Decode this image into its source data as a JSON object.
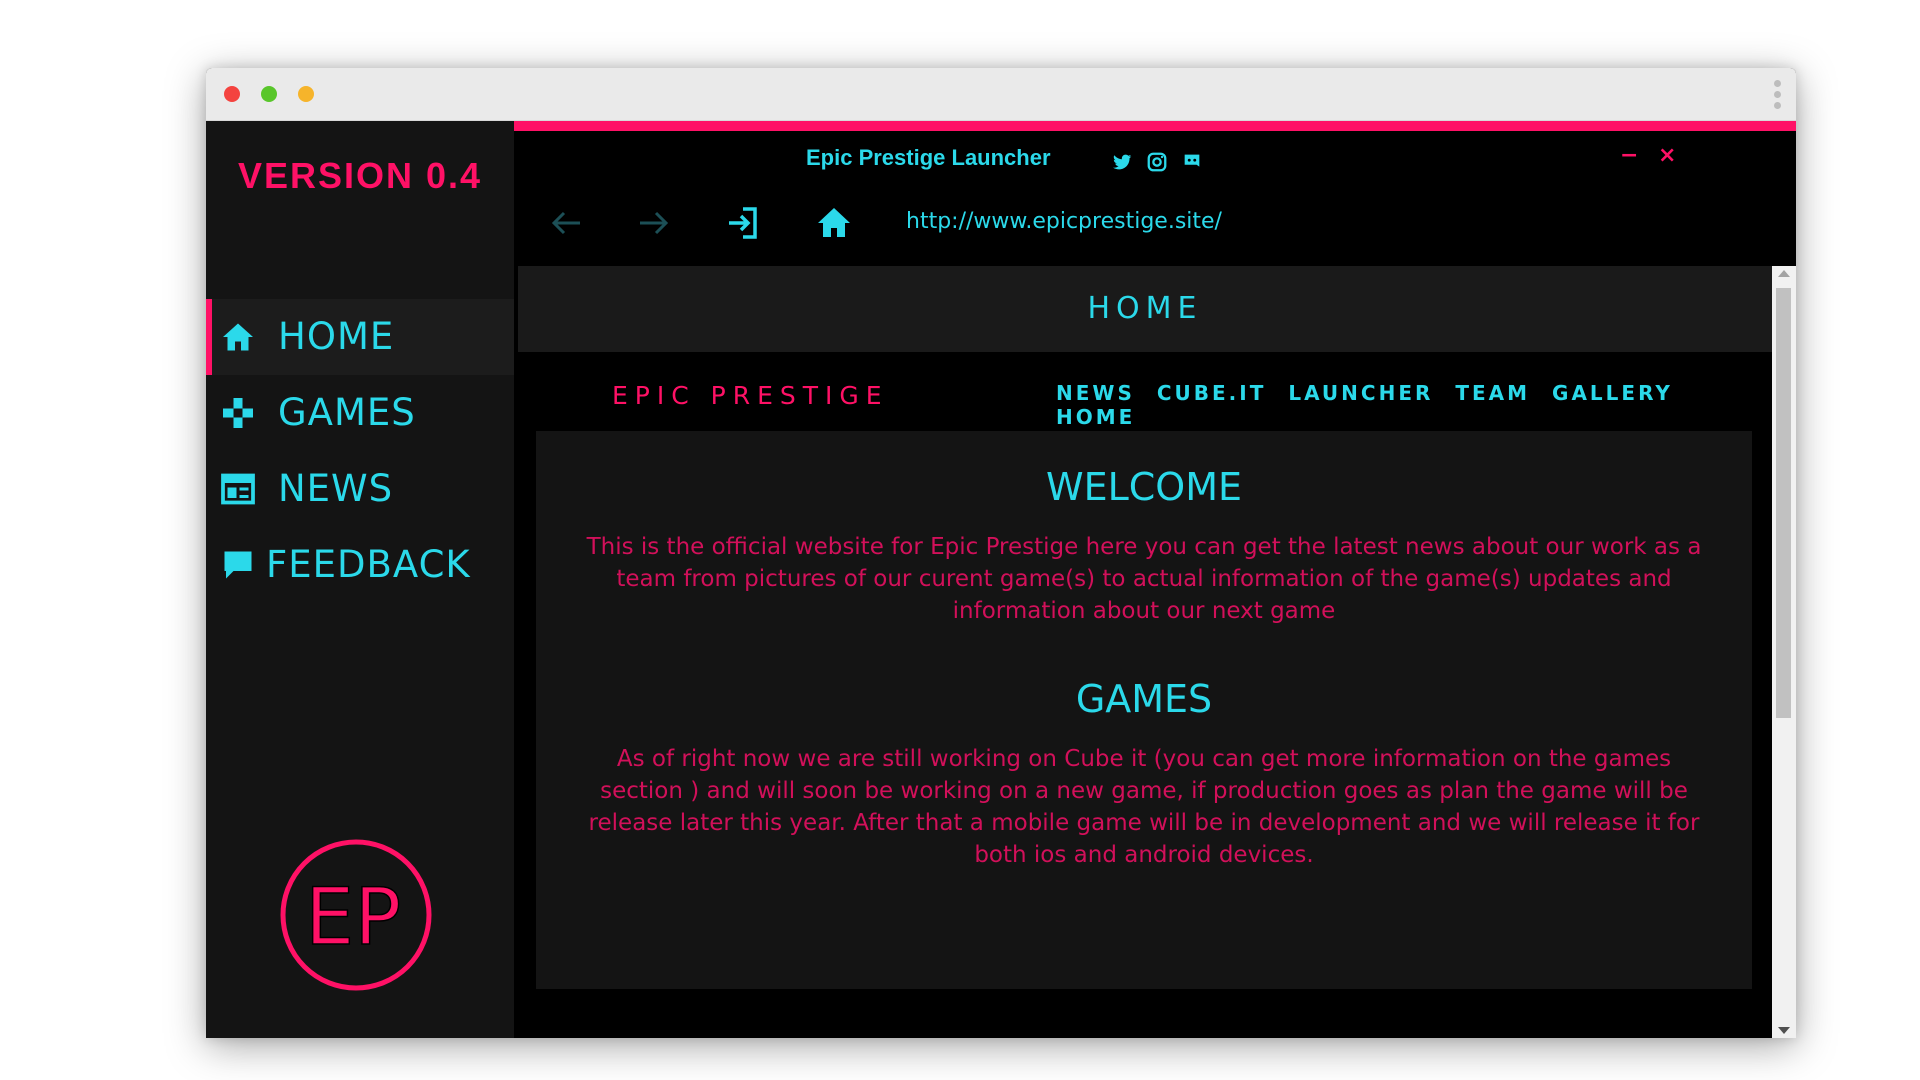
{
  "sidebar": {
    "version": "VERSION 0.4",
    "items": [
      {
        "label": "HOME",
        "icon": "home-icon"
      },
      {
        "label": "GAMES",
        "icon": "gamepad-icon"
      },
      {
        "label": "NEWS",
        "icon": "news-icon"
      },
      {
        "label": "FEEDBACK",
        "icon": "feedback-icon"
      }
    ],
    "logo_text": "EP"
  },
  "titlebar": {
    "title": "Epic Prestige Launcher",
    "social": [
      "twitter-icon",
      "instagram-icon",
      "discord-icon"
    ],
    "minimize": "−",
    "close": "×"
  },
  "toolbar": {
    "url": "http://www.epicprestige.site/"
  },
  "page": {
    "header": "HOME",
    "brand": "EPIC PRESTIGE",
    "menu": [
      "NEWS",
      "CUBE.IT",
      "LAUNCHER",
      "TEAM",
      "GALLERY",
      "HOME"
    ],
    "welcome_title": "WELCOME",
    "welcome_text": "This is the official website for Epic Prestige here you can get the latest news about our work as a team from pictures of our curent game(s) to actual information of the game(s) updates and information about our next game",
    "games_title": "GAMES",
    "games_text": "As of right now we are still working on Cube it (you can get more information on the games section ) and will soon be working on a new game, if production goes as plan the game  will be release later this year. After that a mobile game will be in development and we will release it for both ios and android devices."
  },
  "colors": {
    "accent": "#ff1166",
    "cyan": "#2bd9ea",
    "background": "#000000",
    "sidebar": "#141414"
  }
}
